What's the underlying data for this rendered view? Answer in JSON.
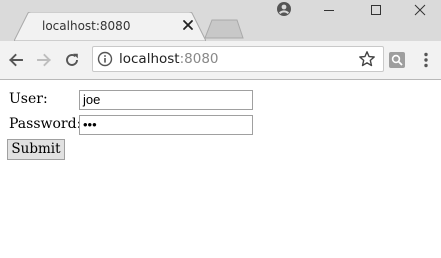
{
  "browser": {
    "tab_title": "localhost:8080",
    "url_host": "localhost",
    "url_port": ":8080",
    "icons": {
      "profile": "profile-icon",
      "minimize": "minimize-icon",
      "maximize": "maximize-icon",
      "close": "close-window-icon",
      "back": "back-arrow-icon",
      "forward": "forward-arrow-icon",
      "reload": "reload-icon",
      "info": "info-icon",
      "bookmark": "star-icon",
      "extension": "extension-icon",
      "menu": "kebab-menu-icon"
    },
    "colors": {
      "titlebar": "#dadada",
      "toolbar": "#f2f2f2",
      "tab_active": "#f2f2f2",
      "tab_inactive": "#c8c8c8"
    }
  },
  "form": {
    "user_label": "User:",
    "user_value": "joe",
    "password_label": "Password:",
    "password_display": "•••",
    "submit_label": "Submit"
  }
}
